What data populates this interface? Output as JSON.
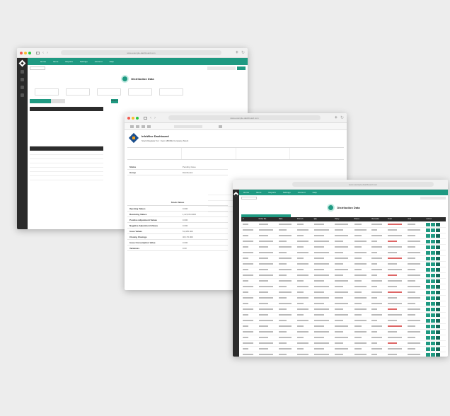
{
  "app": {
    "name": "Distribution Data",
    "brand_color": "#1f9a82",
    "url_text": "www.example-dashboard.com"
  },
  "nav": {
    "items": [
      "Home",
      "Items",
      "Reports",
      "Settings",
      "Account",
      "Help"
    ]
  },
  "back_window": {
    "title": "Distribution Data",
    "button_label": "Search"
  },
  "middle_window": {
    "title": "InfoWise Dashboard",
    "subtitle": "Stock Register For : Item ABCDE Company Stock",
    "details": [
      {
        "key": "Opening Values",
        "value": "0.000"
      },
      {
        "key": "Receiving Values",
        "value": "1,22,035.0000"
      },
      {
        "key": "Positive Adjustment Values",
        "value": "0.000"
      },
      {
        "key": "Negative Adjustment Values",
        "value": "0.000"
      },
      {
        "key": "Issue Values",
        "value": "51,085.000"
      },
      {
        "key": "Closing Closings",
        "value": "46,176.000"
      },
      {
        "key": "Issue Consumption Value",
        "value": "0.000"
      },
      {
        "key": "Variances",
        "value": "0.00"
      }
    ],
    "status_label": "Status",
    "status_value": "Pending Issue",
    "group_label": "Group",
    "group_value": "Distribution",
    "stock_values_label": "Stock Values"
  },
  "front_window": {
    "title": "Distribution Data",
    "table_headers": [
      "#",
      "Order No",
      "Date",
      "Branch",
      "Qty",
      "Party",
      "Status",
      "Remarks",
      "Total",
      "Amt",
      "Action"
    ],
    "row_count": 26
  },
  "icons": [
    "plus-icon",
    "reload-icon",
    "back-icon",
    "forward-icon",
    "tab-icon",
    "logo-icon",
    "edit-icon",
    "view-icon",
    "delete-icon"
  ]
}
